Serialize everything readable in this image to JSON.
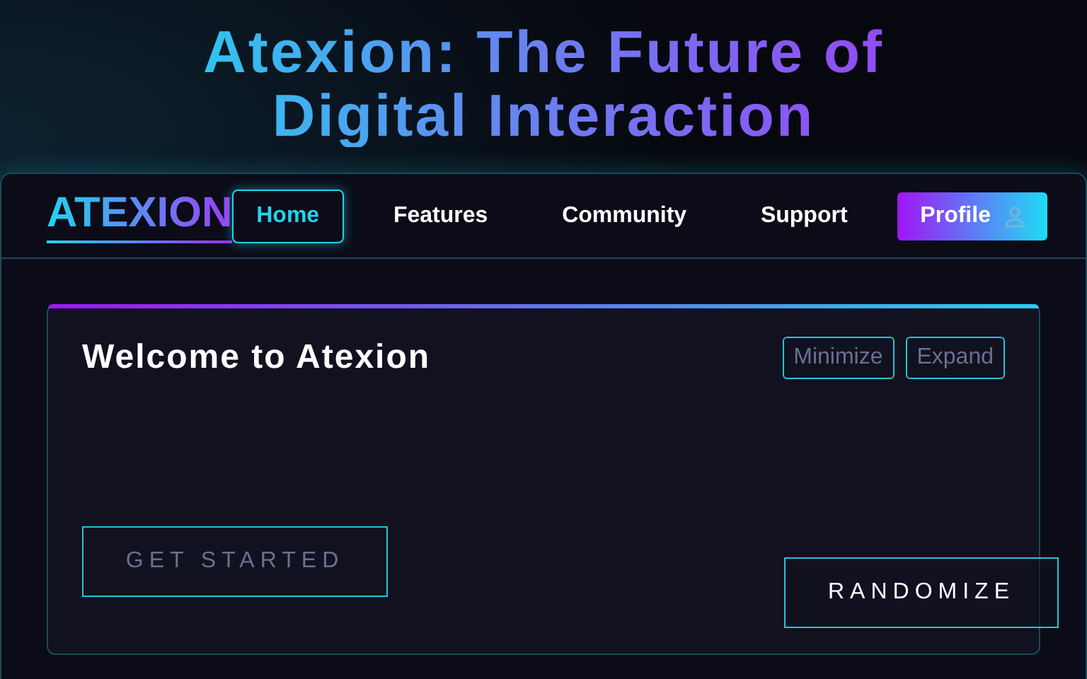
{
  "headline": "Atexion: The Future of Digital Interaction",
  "nav": {
    "logo": "ATEXION",
    "items": [
      {
        "label": "Home",
        "selected": true
      },
      {
        "label": "Features",
        "selected": false
      },
      {
        "label": "Community",
        "selected": false
      },
      {
        "label": "Support",
        "selected": false
      }
    ],
    "profile": "Profile"
  },
  "card": {
    "title": "Welcome to Atexion",
    "actions": [
      "Minimize",
      "Expand"
    ],
    "cta": "GET STARTED"
  },
  "floating_button": "RANDOMIZE"
}
